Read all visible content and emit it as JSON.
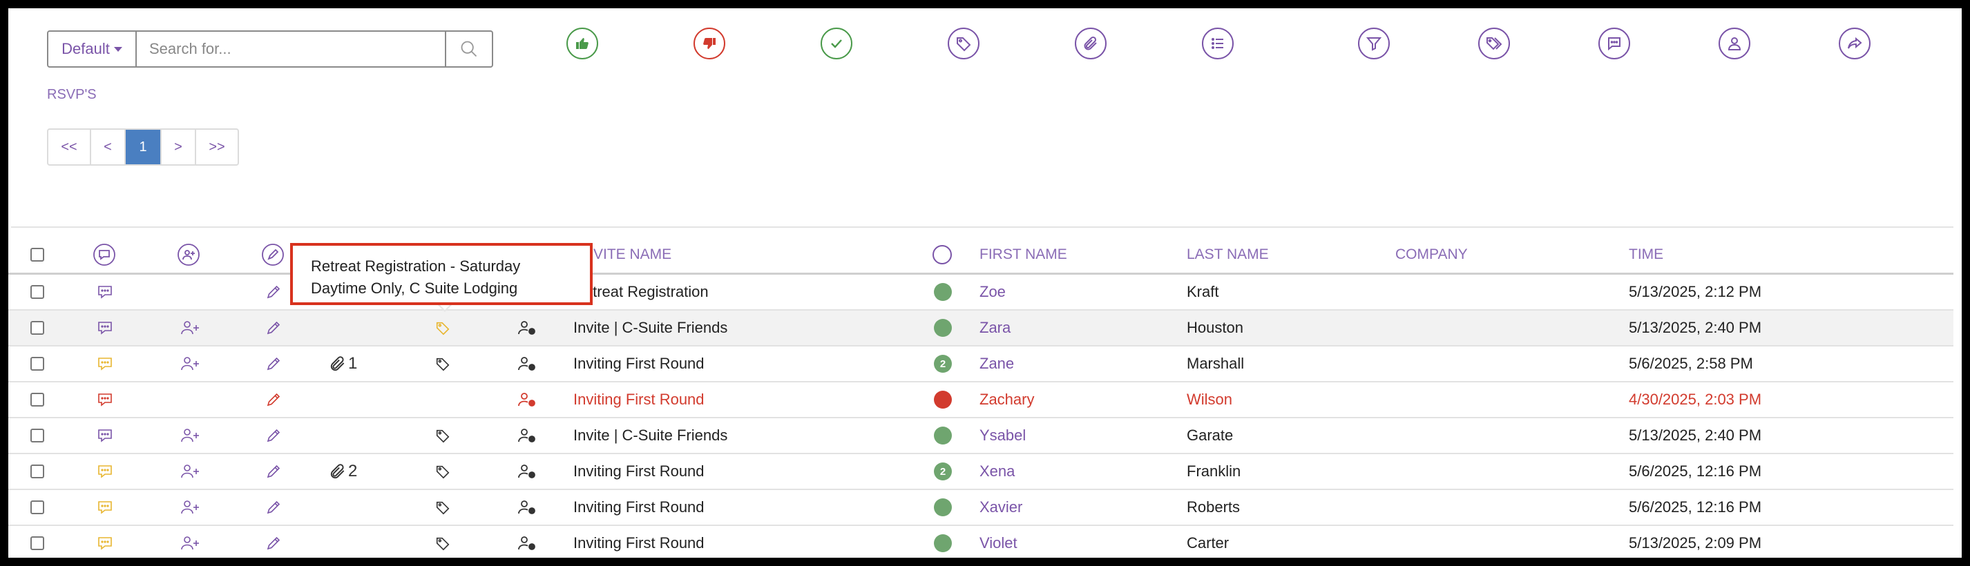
{
  "search": {
    "dropdown_value": "Default",
    "placeholder": "Search for..."
  },
  "toolbar_icons": [
    {
      "name": "thumbs-up-icon",
      "color": "#4a9a4a"
    },
    {
      "name": "thumbs-down-icon",
      "color": "#d23b2e"
    },
    {
      "name": "check-icon",
      "color": "#4a9a4a"
    },
    {
      "name": "tag-icon",
      "color": "#7a54a8"
    },
    {
      "name": "paperclip-icon",
      "color": "#7a54a8"
    },
    {
      "name": "list-icon",
      "color": "#7a54a8"
    },
    {
      "name": "filter-icon",
      "color": "#7a54a8"
    },
    {
      "name": "tags-icon",
      "color": "#7a54a8"
    },
    {
      "name": "comment-icon",
      "color": "#7a54a8"
    },
    {
      "name": "user-icon",
      "color": "#7a54a8"
    },
    {
      "name": "share-icon",
      "color": "#7a54a8"
    }
  ],
  "section_label": "RSVP'S",
  "pagination": {
    "first": "<<",
    "prev": "<",
    "current": "1",
    "next": ">",
    "last": ">>"
  },
  "table": {
    "headers": {
      "invite_name": "INVITE NAME",
      "first_name": "FIRST NAME",
      "last_name": "LAST NAME",
      "company": "COMPANY",
      "time": "TIME"
    },
    "rows": [
      {
        "comment_color": "purple",
        "add_user": false,
        "edit_color": "purple",
        "attach": "",
        "tag_color": "",
        "user_icon": "",
        "invite": "Retreat Registration",
        "status": "green",
        "status_count": "",
        "first": "Zoe",
        "last": "Kraft",
        "company": "",
        "time": "5/13/2025, 2:12 PM",
        "red": false,
        "highlight": false
      },
      {
        "comment_color": "purple",
        "add_user": true,
        "edit_color": "purple",
        "attach": "",
        "tag_color": "yellow",
        "user_icon": "dark",
        "invite": "Invite | C-Suite Friends",
        "status": "green",
        "status_count": "",
        "first": "Zara",
        "last": "Houston",
        "company": "",
        "time": "5/13/2025, 2:40 PM",
        "red": false,
        "highlight": true
      },
      {
        "comment_color": "yellow",
        "add_user": true,
        "edit_color": "purple",
        "attach": "1",
        "tag_color": "dark",
        "user_icon": "dark",
        "invite": "Inviting First Round",
        "status": "green",
        "status_count": "2",
        "first": "Zane",
        "last": "Marshall",
        "company": "",
        "time": "5/6/2025, 2:58 PM",
        "red": false,
        "highlight": false
      },
      {
        "comment_color": "red",
        "add_user": false,
        "edit_color": "red",
        "attach": "",
        "tag_color": "",
        "user_icon": "red",
        "invite": "Inviting First Round",
        "status": "red",
        "status_count": "",
        "first": "Zachary",
        "last": "Wilson",
        "company": "",
        "time": "4/30/2025, 2:03 PM",
        "red": true,
        "highlight": false
      },
      {
        "comment_color": "purple",
        "add_user": true,
        "edit_color": "purple",
        "attach": "",
        "tag_color": "dark",
        "user_icon": "dark",
        "invite": "Invite | C-Suite Friends",
        "status": "green",
        "status_count": "",
        "first": "Ysabel",
        "last": "Garate",
        "company": "",
        "time": "5/13/2025, 2:40 PM",
        "red": false,
        "highlight": false
      },
      {
        "comment_color": "yellow",
        "add_user": true,
        "edit_color": "purple",
        "attach": "2",
        "tag_color": "dark",
        "user_icon": "dark",
        "invite": "Inviting First Round",
        "status": "green",
        "status_count": "2",
        "first": "Xena",
        "last": "Franklin",
        "company": "",
        "time": "5/6/2025, 12:16 PM",
        "red": false,
        "highlight": false
      },
      {
        "comment_color": "yellow",
        "add_user": true,
        "edit_color": "purple",
        "attach": "",
        "tag_color": "dark",
        "user_icon": "dark",
        "invite": "Inviting First Round",
        "status": "green",
        "status_count": "",
        "first": "Xavier",
        "last": "Roberts",
        "company": "",
        "time": "5/6/2025, 12:16 PM",
        "red": false,
        "highlight": false
      },
      {
        "comment_color": "yellow",
        "add_user": true,
        "edit_color": "purple",
        "attach": "",
        "tag_color": "dark",
        "user_icon": "dark",
        "invite": "Inviting First Round",
        "status": "green",
        "status_count": "",
        "first": "Violet",
        "last": "Carter",
        "company": "",
        "time": "5/13/2025, 2:09 PM",
        "red": false,
        "highlight": false
      }
    ]
  },
  "tooltip": {
    "line1": "Retreat Registration - Saturday",
    "line2": "Daytime Only, C Suite Lodging"
  },
  "colors": {
    "purple": "#7a54a8",
    "green": "#6fa56f",
    "red": "#d23b2e",
    "yellow": "#e8b630",
    "accent_blue": "#4a7fc1"
  }
}
